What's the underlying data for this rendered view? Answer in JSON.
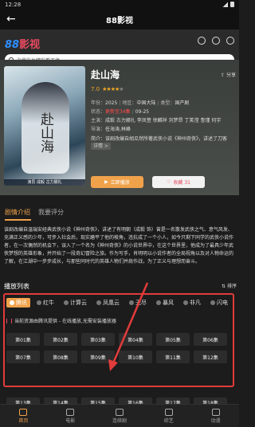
{
  "status": {
    "time": "12:28"
  },
  "titlebar": {
    "title": "88影视"
  },
  "logo": {
    "num": "88",
    "text": "影视"
  },
  "search": {
    "placeholder": "海量影片精彩看不停"
  },
  "detail": {
    "title": "赴山海",
    "share": "分享",
    "score": "7.0",
    "stars_on": "★★★★",
    "stars_off": "★",
    "poster_calligraphy": "赴山海",
    "poster_band": "演员 成毅 古力娜扎",
    "year_label": "年份：",
    "year": "2025",
    "region_label": "地区：",
    "region": "中国大陆",
    "type_label": "类型：",
    "type": "国产剧",
    "status_label": "状态：",
    "status": "更新至34集",
    "date": "09-25",
    "cast_label": "主演：",
    "cast": "成毅 古力娜扎 李凤萱 徐麟祥 刘梦昂 丁笑滢 鲁瑾 何宇",
    "director_label": "导演：",
    "director": "任海涛,林峰",
    "summary_label": "简介：",
    "summary": "该剧改编自胡瓜然所著武侠小说《神州奇侠》，讲述了刀客",
    "more": "详情 >",
    "play_btn": "立即播放",
    "fav_btn": "收藏 31"
  },
  "tabs": [
    {
      "label": "剧情介绍"
    },
    {
      "label": "我要评分"
    }
  ],
  "synopsis": "该剧改编自温瑞安经典武侠小说《神州奇侠》，讲述了有明朝（成毅 饰）曾是一名散发武侠之气、意气风发、充满正义感的少年，可步入社会后，现实磨平了他的棱角，违抗成了一个小人，如今只剩下同学的武侠小说作者，在一次偶然的机会下，误入了一个名为《神州奇侠》的小说世界中，在这个世界里，他成为了最具少年武侠梦想的英雄形象，并开始了一段奇幻冒险之旅。作为写手，肖明明以小说作者的全局视角以及对人物命运的了解，在江湖中一步步成长，与那些同时代的英雄人物们并肩作战，为了正义与理想而奋斗。",
  "playlist": {
    "title": "播放列表",
    "sort": "排序"
  },
  "sources": [
    {
      "label": "腾讯"
    },
    {
      "label": "红牛"
    },
    {
      "label": "计算云"
    },
    {
      "label": "凤凰云"
    },
    {
      "label": "无尽"
    },
    {
      "label": "暴风"
    },
    {
      "label": "非凡"
    },
    {
      "label": "闪电"
    }
  ],
  "notice": "当前资源由腾讯提供 - 在线播放,无需安装播放器",
  "episodes": [
    "第01集",
    "第02集",
    "第03集",
    "第04集",
    "第05集",
    "第06集",
    "第07集",
    "第08集",
    "第09集",
    "第10集",
    "第11集",
    "第12集"
  ],
  "episodes_partial": [
    "第13集",
    "第14集",
    "第15集",
    "第16集",
    "第17集",
    "第18集"
  ],
  "nav": [
    {
      "label": "首页"
    },
    {
      "label": "电影"
    },
    {
      "label": "连续剧"
    },
    {
      "label": "综艺"
    },
    {
      "label": "动漫"
    }
  ],
  "colors": {
    "accent": "#f0a24b",
    "highlight_box": "#e23b3b",
    "brand_red": "#e84a5f"
  }
}
